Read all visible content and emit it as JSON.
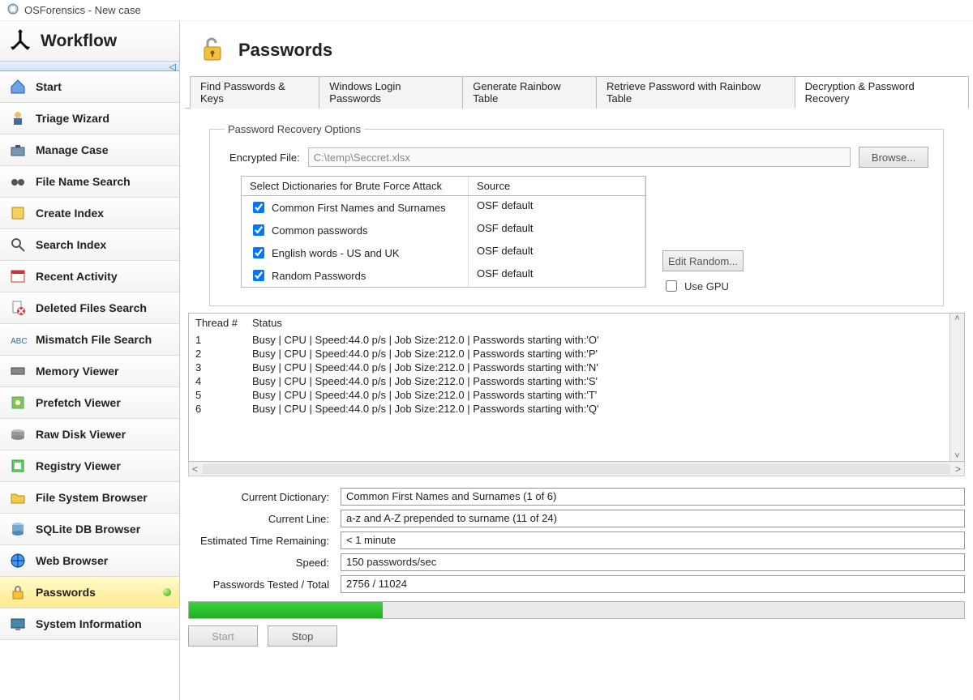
{
  "window_title": "OSForensics - New case",
  "sidebar": {
    "header": "Workflow",
    "items": [
      {
        "label": "Start",
        "active": false,
        "icon": "home-icon"
      },
      {
        "label": "Triage Wizard",
        "active": false,
        "icon": "wizard-icon"
      },
      {
        "label": "Manage Case",
        "active": false,
        "icon": "briefcase-icon"
      },
      {
        "label": "File Name Search",
        "active": false,
        "icon": "binoculars-icon"
      },
      {
        "label": "Create Index",
        "active": false,
        "icon": "index-icon"
      },
      {
        "label": "Search Index",
        "active": false,
        "icon": "search-icon"
      },
      {
        "label": "Recent Activity",
        "active": false,
        "icon": "clock-icon"
      },
      {
        "label": "Deleted Files Search",
        "active": false,
        "icon": "deleted-icon"
      },
      {
        "label": "Mismatch File Search",
        "active": false,
        "icon": "mismatch-icon"
      },
      {
        "label": "Memory Viewer",
        "active": false,
        "icon": "memory-icon"
      },
      {
        "label": "Prefetch Viewer",
        "active": false,
        "icon": "prefetch-icon"
      },
      {
        "label": "Raw Disk Viewer",
        "active": false,
        "icon": "disk-icon"
      },
      {
        "label": "Registry Viewer",
        "active": false,
        "icon": "registry-icon"
      },
      {
        "label": "File System Browser",
        "active": false,
        "icon": "folder-icon"
      },
      {
        "label": "SQLite DB Browser",
        "active": false,
        "icon": "database-icon"
      },
      {
        "label": "Web Browser",
        "active": false,
        "icon": "web-icon"
      },
      {
        "label": "Passwords",
        "active": true,
        "icon": "lock-icon"
      },
      {
        "label": "System Information",
        "active": false,
        "icon": "sysinfo-icon"
      }
    ]
  },
  "page": {
    "title": "Passwords",
    "tabs": [
      {
        "label": "Find Passwords & Keys",
        "active": false
      },
      {
        "label": "Windows Login Passwords",
        "active": false
      },
      {
        "label": "Generate Rainbow Table",
        "active": false
      },
      {
        "label": "Retrieve Password with Rainbow Table",
        "active": false
      },
      {
        "label": "Decryption & Password Recovery",
        "active": true
      }
    ]
  },
  "recovery": {
    "groupLabel": "Password Recovery Options",
    "encLabel": "Encrypted File:",
    "encValue": "C:\\temp\\Seccret.xlsx",
    "browse": "Browse...",
    "dictHeaderName": "Select Dictionaries for Brute Force Attack",
    "dictHeaderSource": "Source",
    "dicts": [
      {
        "name": "Common First Names and Surnames",
        "source": "OSF default",
        "checked": true
      },
      {
        "name": "Common passwords",
        "source": "OSF default",
        "checked": true
      },
      {
        "name": "English words - US and UK",
        "source": "OSF default",
        "checked": true
      },
      {
        "name": "Random Passwords",
        "source": "OSF default",
        "checked": true
      }
    ],
    "editRandom": "Edit Random...",
    "useGpuLabel": "Use GPU",
    "useGpuChecked": false
  },
  "threads": {
    "headerNum": "Thread #",
    "headerStatus": "Status",
    "rows": [
      {
        "n": "1",
        "status": "Busy | CPU | Speed:44.0 p/s | Job Size:212.0 | Passwords starting with:'O'"
      },
      {
        "n": "2",
        "status": "Busy | CPU | Speed:44.0 p/s | Job Size:212.0 | Passwords starting with:'P'"
      },
      {
        "n": "3",
        "status": "Busy | CPU | Speed:44.0 p/s | Job Size:212.0 | Passwords starting with:'N'"
      },
      {
        "n": "4",
        "status": "Busy | CPU | Speed:44.0 p/s | Job Size:212.0 | Passwords starting with:'S'"
      },
      {
        "n": "5",
        "status": "Busy | CPU | Speed:44.0 p/s | Job Size:212.0 | Passwords starting with:'T'"
      },
      {
        "n": "6",
        "status": "Busy | CPU | Speed:44.0 p/s | Job Size:212.0 | Passwords starting with:'Q'"
      }
    ]
  },
  "stats": {
    "labels": {
      "currentDict": "Current Dictionary:",
      "currentLine": "Current Line:",
      "eta": "Estimated Time Remaining:",
      "speed": "Speed:",
      "tested": "Passwords Tested / Total"
    },
    "values": {
      "currentDict": "Common First Names and Surnames (1 of 6)",
      "currentLine": "a-z and A-Z  prepended to surname (11 of 24)",
      "eta": "< 1 minute",
      "speed": "150 passwords/sec",
      "tested": "2756 / 11024"
    },
    "progressPercent": 25
  },
  "buttons": {
    "start": "Start",
    "stop": "Stop"
  }
}
